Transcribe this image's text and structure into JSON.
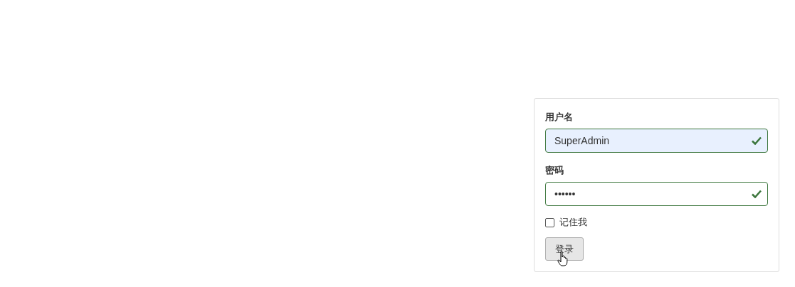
{
  "login_form": {
    "fields": [
      {
        "label": "用户名",
        "value": "SuperAdmin",
        "valid": true,
        "autofilled": true
      },
      {
        "label": "密码",
        "value": "••••••",
        "valid": true,
        "autofilled": false
      }
    ],
    "remember": {
      "label": "记住我",
      "checked": false
    },
    "submit": {
      "label": "登录"
    }
  }
}
